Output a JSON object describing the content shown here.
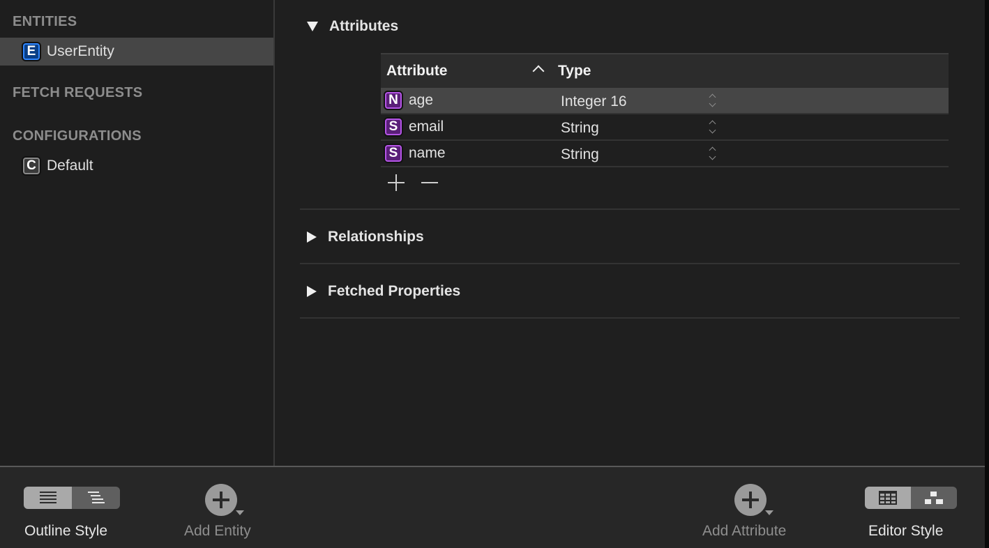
{
  "sidebar": {
    "sections": {
      "entities": "ENTITIES",
      "fetch_requests": "FETCH REQUESTS",
      "configurations": "CONFIGURATIONS"
    },
    "entities": [
      {
        "badge": "E",
        "label": "UserEntity",
        "selected": true
      }
    ],
    "configurations": [
      {
        "badge": "C",
        "label": "Default"
      }
    ]
  },
  "editor": {
    "attributes_section": {
      "title": "Attributes",
      "expanded": true,
      "columns": {
        "attribute": "Attribute",
        "type": "Type",
        "sort": "ascending"
      },
      "rows": [
        {
          "badge": "N",
          "name": "age",
          "type": "Integer 16",
          "selected": true
        },
        {
          "badge": "S",
          "name": "email",
          "type": "String",
          "selected": false
        },
        {
          "badge": "S",
          "name": "name",
          "type": "String",
          "selected": false
        }
      ],
      "add_icon": "plus-icon",
      "remove_icon": "minus-icon"
    },
    "relationships_section": {
      "title": "Relationships",
      "expanded": false
    },
    "fetched_properties_section": {
      "title": "Fetched Properties",
      "expanded": false
    }
  },
  "bottom_bar": {
    "outline_style": {
      "label": "Outline Style",
      "options": [
        "flat-list-icon",
        "hierarchical-list-icon"
      ],
      "selected": 0
    },
    "add_entity": {
      "label": "Add Entity"
    },
    "add_attribute": {
      "label": "Add Attribute"
    },
    "editor_style": {
      "label": "Editor Style",
      "options": [
        "table-icon",
        "graph-icon"
      ],
      "selected": 0
    }
  }
}
